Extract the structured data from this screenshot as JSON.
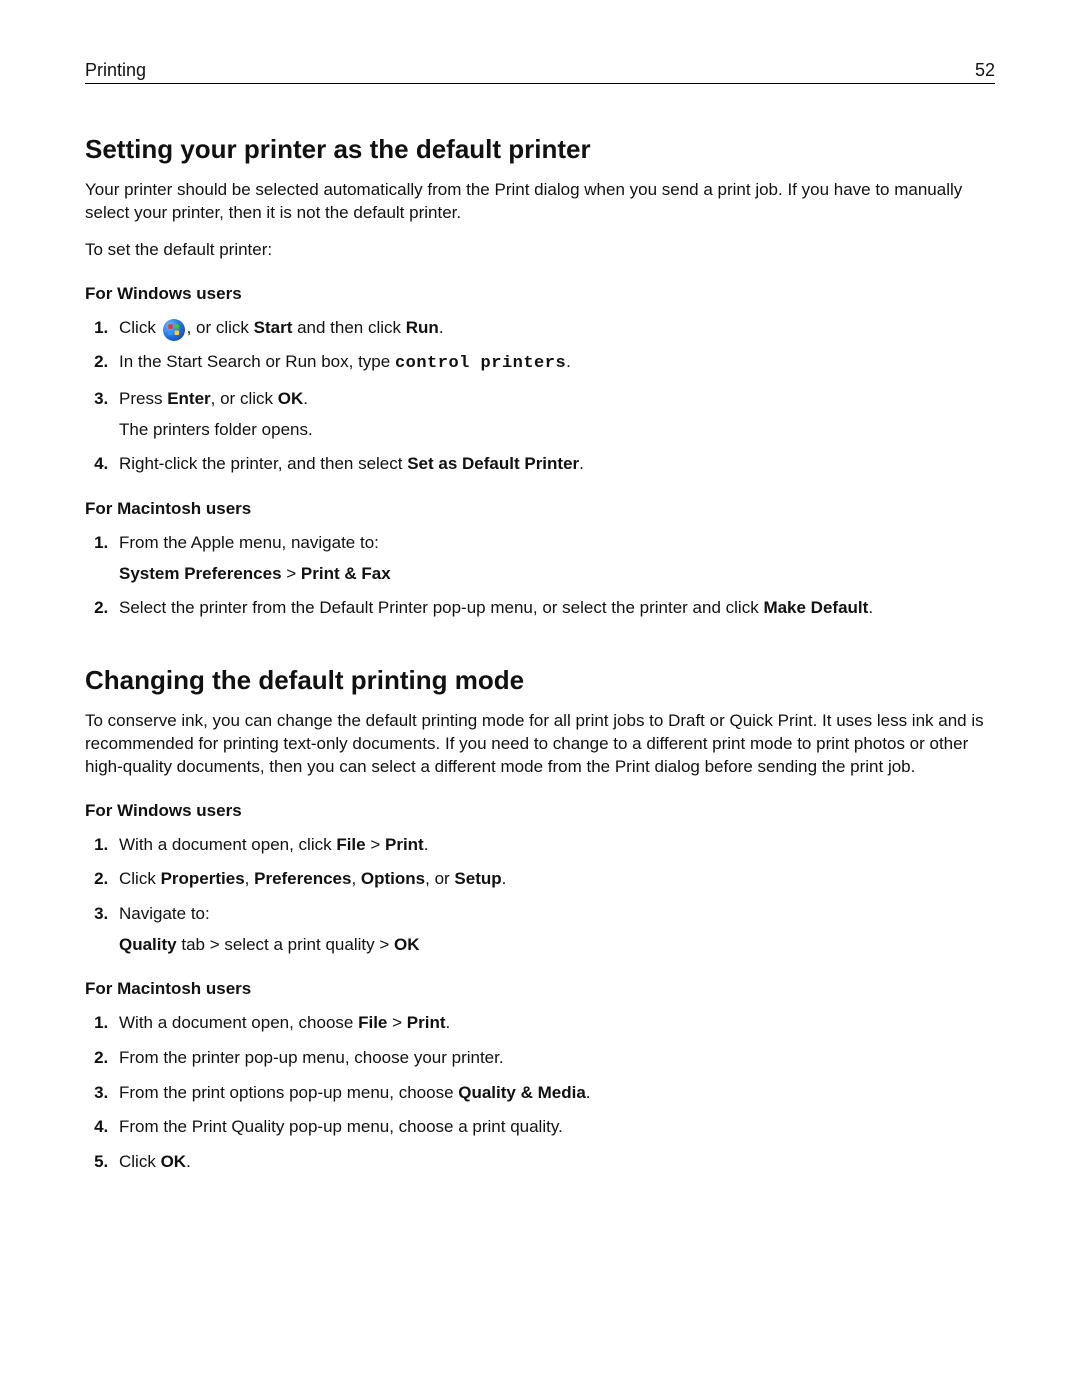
{
  "header": {
    "section": "Printing",
    "page": "52"
  },
  "sec1": {
    "title": "Setting your printer as the default printer",
    "intro": "Your printer should be selected automatically from the Print dialog when you send a print job. If you have to manually select your printer, then it is not the default printer.",
    "lead": "To set the default printer:",
    "win": {
      "heading": "For Windows users",
      "s1a": "Click ",
      "s1b": ", or click ",
      "s1c": " and then click ",
      "start": "Start",
      "run": "Run",
      "s1end": ".",
      "s2a": "In the Start Search or Run box, type ",
      "code": "control printers",
      "s2end": ".",
      "s3a": "Press ",
      "enter": "Enter",
      "s3b": ", or click ",
      "ok": "OK",
      "s3end": ".",
      "s3note": "The printers folder opens.",
      "s4a": "Right-click the printer, and then select ",
      "s4b": "Set as Default Printer",
      "s4end": "."
    },
    "mac": {
      "heading": "For Macintosh users",
      "s1": "From the Apple menu, navigate to:",
      "path1": "System Preferences",
      "gt": " > ",
      "path2": "Print & Fax",
      "s2a": "Select the printer from the Default Printer pop-up menu, or select the printer and click ",
      "s2b": "Make Default",
      "s2end": "."
    }
  },
  "sec2": {
    "title": "Changing the default printing mode",
    "intro": "To conserve ink, you can change the default printing mode for all print jobs to Draft or Quick Print. It uses less ink and is recommended for printing text-only documents. If you need to change to a different print mode to print photos or other high-quality documents, then you can select a different mode from the Print dialog before sending the print job.",
    "win": {
      "heading": "For Windows users",
      "s1a": "With a document open, click ",
      "file": "File",
      "gt": " > ",
      "print": "Print",
      "s1end": ".",
      "s2a": "Click ",
      "p1": "Properties",
      "c": ", ",
      "p2": "Preferences",
      "p3": "Options",
      "or": ", or ",
      "p4": "Setup",
      "s2end": ".",
      "s3": "Navigate to:",
      "q": "Quality",
      "qtail": " tab > select a print quality > ",
      "ok": "OK"
    },
    "mac": {
      "heading": "For Macintosh users",
      "s1a": "With a document open, choose ",
      "file": "File",
      "gt": " > ",
      "print": "Print",
      "s1end": ".",
      "s2": "From the printer pop-up menu, choose your printer.",
      "s3a": "From the print options pop-up menu, choose ",
      "qm": "Quality & Media",
      "s3end": ".",
      "s4": "From the Print Quality pop-up menu, choose a print quality.",
      "s5a": "Click ",
      "ok": "OK",
      "s5end": "."
    }
  }
}
